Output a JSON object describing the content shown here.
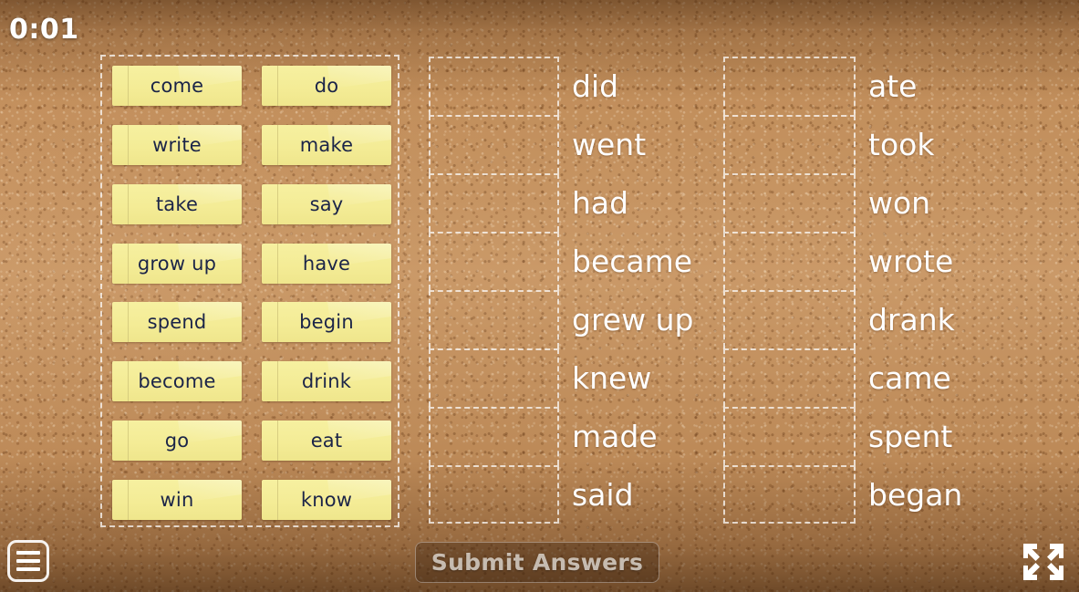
{
  "timer": {
    "label": "0:01"
  },
  "tiles": [
    {
      "label": "come"
    },
    {
      "label": "do"
    },
    {
      "label": "write"
    },
    {
      "label": "make"
    },
    {
      "label": "take"
    },
    {
      "label": "say"
    },
    {
      "label": "grow up"
    },
    {
      "label": "have"
    },
    {
      "label": "spend"
    },
    {
      "label": "begin"
    },
    {
      "label": "become"
    },
    {
      "label": "drink"
    },
    {
      "label": "go"
    },
    {
      "label": "eat"
    },
    {
      "label": "win"
    },
    {
      "label": "know"
    }
  ],
  "answers": {
    "left_column": [
      {
        "word": "did",
        "dropzone_empty": true
      },
      {
        "word": "went",
        "dropzone_empty": true
      },
      {
        "word": "had",
        "dropzone_empty": true
      },
      {
        "word": "became",
        "dropzone_empty": true
      },
      {
        "word": "grew up",
        "dropzone_empty": true
      },
      {
        "word": "knew",
        "dropzone_empty": true
      },
      {
        "word": "made",
        "dropzone_empty": true
      },
      {
        "word": "said",
        "dropzone_empty": true
      }
    ],
    "right_column": [
      {
        "word": "ate",
        "dropzone_empty": true
      },
      {
        "word": "took",
        "dropzone_empty": true
      },
      {
        "word": "won",
        "dropzone_empty": true
      },
      {
        "word": "wrote",
        "dropzone_empty": true
      },
      {
        "word": "drank",
        "dropzone_empty": true
      },
      {
        "word": "came",
        "dropzone_empty": true
      },
      {
        "word": "spent",
        "dropzone_empty": true
      },
      {
        "word": "began",
        "dropzone_empty": true
      }
    ]
  },
  "controls": {
    "submit_label": "Submit Answers",
    "menu_icon": "hamburger-menu-icon",
    "fullscreen_icon": "fullscreen-expand-icon"
  },
  "colors": {
    "background_brown": "#c4915e",
    "tile_yellow": "#f4ec96",
    "tile_text": "#1b2448",
    "answer_text": "#ffffff",
    "dashed_border": "#ffffff",
    "submit_text": "#e8e2da"
  }
}
